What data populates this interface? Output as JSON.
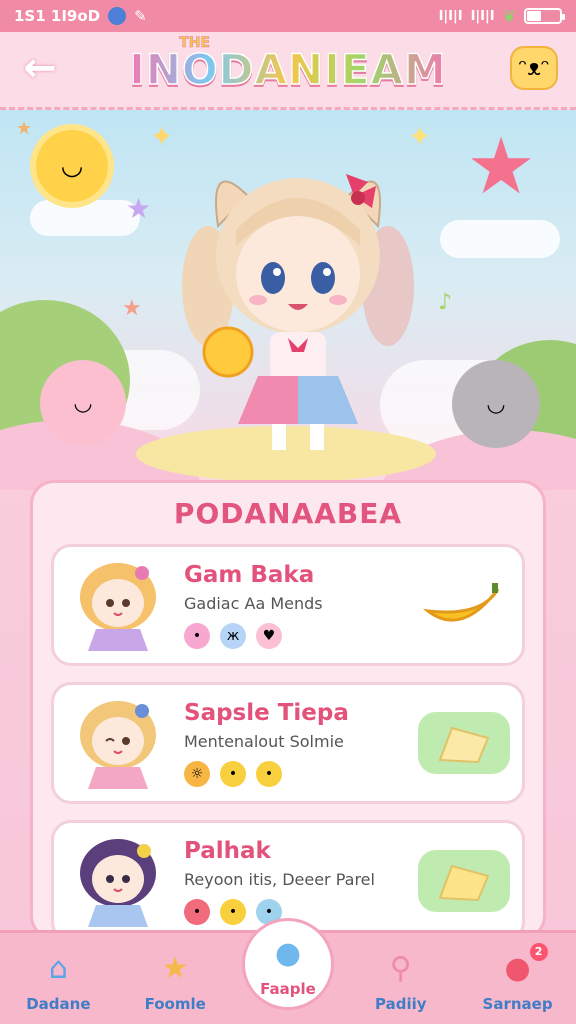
{
  "status_bar": {
    "time": "1S1 1I9oD",
    "signal_text": "I|I|I",
    "wifi_text": "I|I|I",
    "battery_percent": 45
  },
  "header": {
    "small_title": "THE",
    "title": "INODANIEAM",
    "back_icon": "arrow-left-icon",
    "mascot_icon": "cat-face-icon"
  },
  "panel": {
    "title": "PODANAABEA",
    "cards": [
      {
        "name": "Gam Baka",
        "desc": "Gadiac Aa Mends",
        "icons": [
          "pink-blob-icon",
          "blue-butterfly-icon",
          "pink-heart-icon"
        ],
        "item_icon": "banana-icon",
        "item_bg": "none"
      },
      {
        "name": "Sapsle Tiepa",
        "desc": "Mentenalout Solmie",
        "icons": [
          "sun-face-icon",
          "yellow-chick-icon",
          "yellow-chick-icon"
        ],
        "item_icon": "cheese-icon",
        "item_bg": "green"
      },
      {
        "name": "Palhak",
        "desc": "Reyoon itis, Deeer Parel",
        "icons": [
          "red-blob-icon",
          "yellow-face-icon",
          "blue-bear-icon"
        ],
        "item_icon": "cheese-icon",
        "item_bg": "green"
      }
    ]
  },
  "nav": {
    "items": [
      {
        "label": "Dadane",
        "icon": "house-icon"
      },
      {
        "label": "Foomle",
        "icon": "star-friends-icon"
      },
      {
        "label": "Faaple",
        "icon": "chat-bubble-icon",
        "active": true
      },
      {
        "label": "Padiiy",
        "icon": "search-icon"
      },
      {
        "label": "Sarnaep",
        "icon": "red-ball-icon",
        "badge": "2"
      }
    ]
  },
  "colors": {
    "accent": "#e3527b",
    "status_bar": "#f08aa5",
    "nav_bg": "#f7b8cb",
    "nav_label": "#3f7ec7"
  }
}
